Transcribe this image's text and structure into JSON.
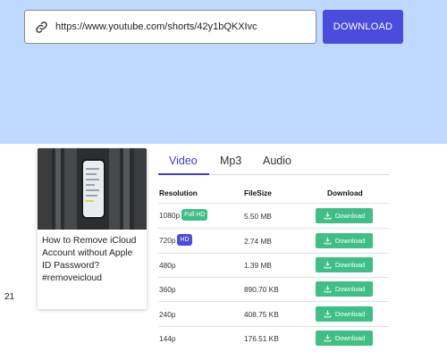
{
  "search": {
    "url_value": "https://www.youtube.com/shorts/42y1bQKXIvc",
    "link_icon": "link-icon",
    "download_label": "DOWNLOAD"
  },
  "colors": {
    "hero_bg": "#bfd9ff",
    "primary": "#4b4bdc",
    "download_green": "#3fbf85",
    "full_hd_badge": "#3fbf85",
    "hd_badge": "#4b4bdc"
  },
  "video": {
    "title": "How to Remove iCloud Account without Apple ID Password? #removeicloud",
    "count": "21"
  },
  "tabs": [
    {
      "label": "Video",
      "active": true
    },
    {
      "label": "Mp3",
      "active": false
    },
    {
      "label": "Audio",
      "active": false
    }
  ],
  "table": {
    "headers": {
      "resolution": "Resolution",
      "filesize": "FileSize",
      "download": "Download"
    },
    "rows": [
      {
        "resolution": "1080p",
        "badge": "Full HD",
        "filesize": "5.50 MB",
        "action": "Download"
      },
      {
        "resolution": "720p",
        "badge": "HD",
        "filesize": "2.74 MB",
        "action": "Download"
      },
      {
        "resolution": "480p",
        "badge": "",
        "filesize": "1.39 MB",
        "action": "Download"
      },
      {
        "resolution": "360p",
        "badge": "",
        "filesize": "890.70 KB",
        "action": "Download"
      },
      {
        "resolution": "240p",
        "badge": "",
        "filesize": "408.75 KB",
        "action": "Download"
      },
      {
        "resolution": "144p",
        "badge": "",
        "filesize": "176.51 KB",
        "action": "Download"
      }
    ]
  }
}
